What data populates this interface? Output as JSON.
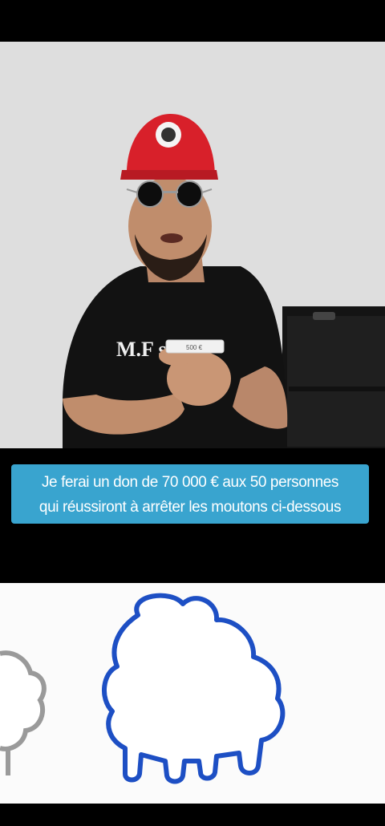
{
  "video": {
    "cap_color": "#d8202a",
    "shirt_text": "M.F      se",
    "note_text": "500 €"
  },
  "caption": {
    "line1": "Je ferai un don de 70 000 € aux 50 personnes",
    "line2": "qui réussiront à arrêter les moutons ci-dessous",
    "background": "#39a4cf"
  },
  "sheep": {
    "main_outline_color": "#1d4fc4",
    "partial_outline_color": "#9a9a9a"
  }
}
